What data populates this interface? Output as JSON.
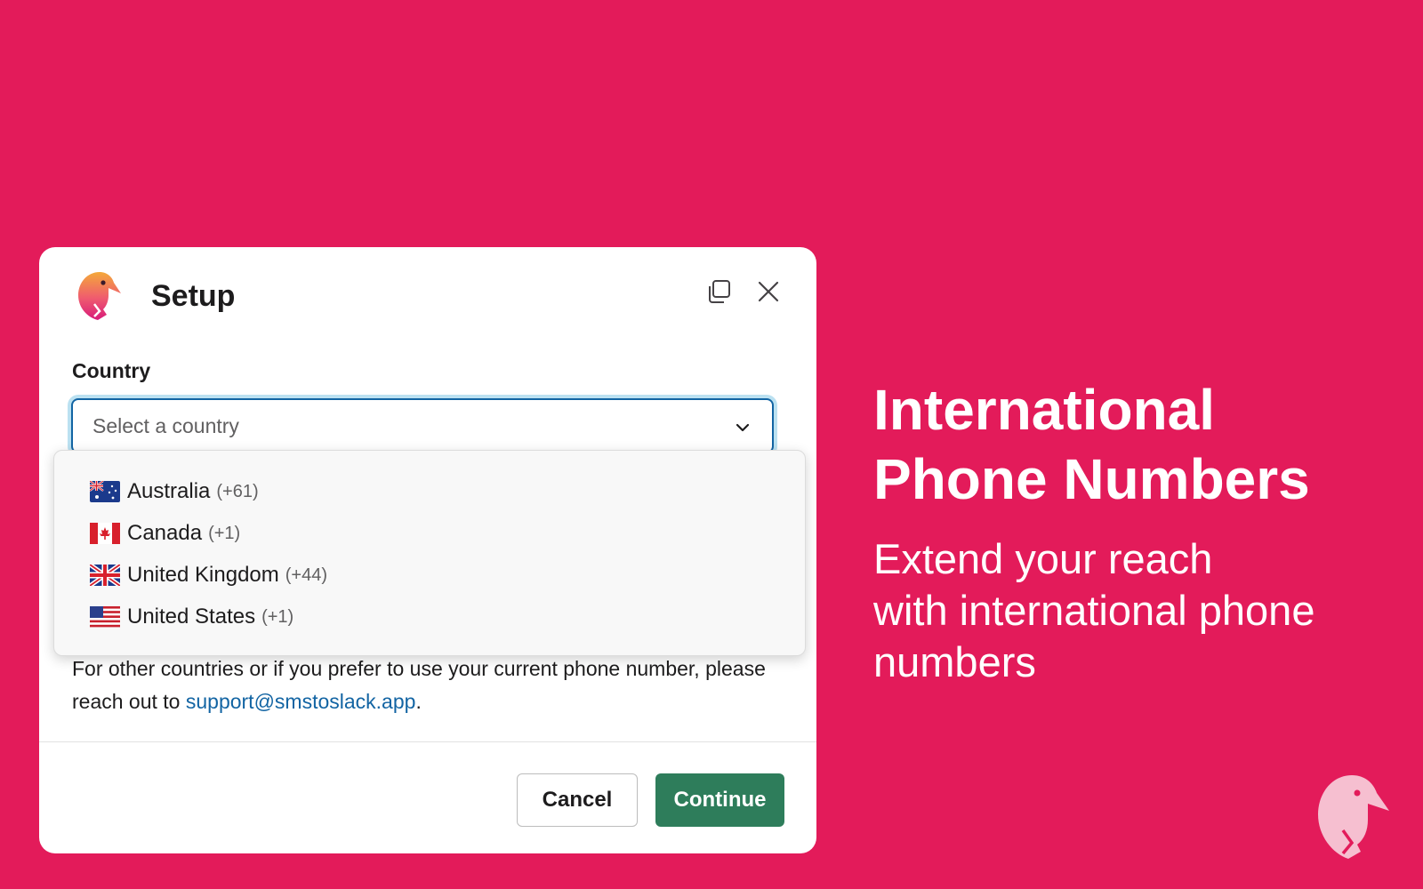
{
  "modal": {
    "title": "Setup",
    "header_icons": [
      "app-logo-icon",
      "popout-icon",
      "close-icon"
    ],
    "country_label": "Country",
    "country_select": {
      "placeholder": "Select a country",
      "options": [
        {
          "flag": "australia-flag-icon",
          "name": "Australia",
          "code": "(+61)"
        },
        {
          "flag": "canada-flag-icon",
          "name": "Canada",
          "code": "(+1)"
        },
        {
          "flag": "uk-flag-icon",
          "name": "United Kingdom",
          "code": "(+44)"
        },
        {
          "flag": "us-flag-icon",
          "name": "United States",
          "code": "(+1)"
        }
      ]
    },
    "help_text_prefix": "For other countries or if you prefer to use your current phone number, please reach out to ",
    "help_link": "support@smstoslack.app",
    "help_text_suffix": ".",
    "cancel_label": "Cancel",
    "continue_label": "Continue"
  },
  "promo": {
    "headline": "International\nPhone Numbers",
    "subline": "Extend your reach\nwith international phone\nnumbers"
  },
  "colors": {
    "background": "#E31B5A",
    "continue_button": "#2E7D5B",
    "link": "#1264A3",
    "focus_border": "#1264A3"
  }
}
